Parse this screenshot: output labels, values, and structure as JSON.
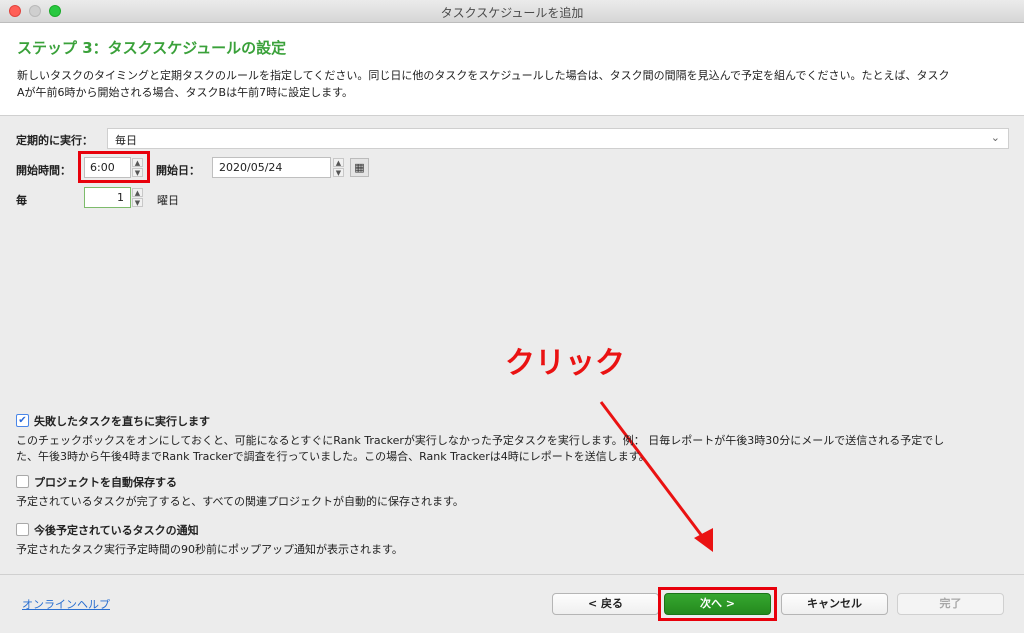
{
  "window": {
    "title": "タスクスケジュールを追加"
  },
  "header": {
    "step_title": "ステップ 3：タスクスケジュールの設定",
    "desc_line1": "新しいタスクのタイミングと定期タスクのルールを指定してください。同じ日に他のタスクをスケジュールした場合は、タスク間の間隔を見込んで予定を組んでください。たとえば、タスク",
    "desc_line2": "Aが午前6時から開始される場合、タスクBは午前7時に設定します。"
  },
  "form": {
    "repeat_label": "定期的に実行：",
    "repeat_value": "毎日",
    "start_time_label": "開始時間：",
    "start_time_value": "6:00",
    "start_date_label": "開始日：",
    "start_date_value": "2020/05/24",
    "every_label": "毎",
    "every_value": "1",
    "every_unit": "曜日"
  },
  "options": [
    {
      "label": "失敗したタスクを直ちに実行します",
      "checked": true,
      "desc1": "このチェックボックスをオンにしておくと、可能になるとすぐにRank Trackerが実行しなかった予定タスクを実行します。例： 日毎レポートが午後3時30分にメールで送信される予定でし",
      "desc2": "た、午後3時から午後4時までRank Trackerで調査を行っていました。この場合、Rank Trackerは4時にレポートを送信します。"
    },
    {
      "label": "プロジェクトを自動保存する",
      "checked": false,
      "desc1": "予定されているタスクが完了すると、すべての関連プロジェクトが自動的に保存されます。"
    },
    {
      "label": "今後予定されているタスクの通知",
      "checked": false,
      "desc1": "予定されたタスク実行予定時間の90秒前にポップアップ通知が表示されます。"
    }
  ],
  "footer": {
    "help_link": "オンラインヘルプ",
    "back_button": "< 戻る",
    "next_button": "次へ >",
    "cancel_button": "キャンセル",
    "finish_button": "完了"
  },
  "annotation": {
    "text": "クリック"
  },
  "colors": {
    "accent_green": "#3aa13a",
    "annotation_red": "#e8000b",
    "link_blue": "#2a6fd0"
  }
}
